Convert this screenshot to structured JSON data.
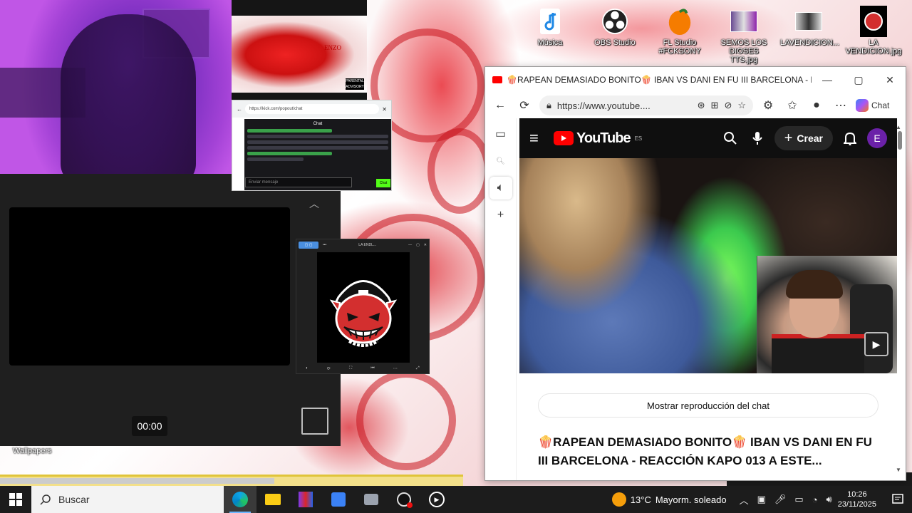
{
  "desktop": {
    "wallpapers_label": "Wallpapers",
    "icons": [
      {
        "label": "Música",
        "icon": "music-note-icon"
      },
      {
        "label": "OBS Studio",
        "icon": "obs-icon"
      },
      {
        "label": "FL Studio #FCKSONY",
        "icon": "fl-studio-icon"
      },
      {
        "label": "SEMOS LOS DIOSES TTS.jpg",
        "icon": "image-file-icon"
      },
      {
        "label": "LAVENDICION...",
        "icon": "image-file-icon"
      },
      {
        "label": "LA VENDICION.jpg",
        "icon": "image-file-icon"
      }
    ]
  },
  "media_player": {
    "time": "00:00"
  },
  "album": {
    "tag": "ENZO"
  },
  "chat_popup": {
    "title": "Chat",
    "url": "https://kick.com/popout/chat",
    "input_placeholder": "Enviar mensaje",
    "send_label": "Chat"
  },
  "viewer": {
    "title": "LA ENDL..."
  },
  "browser": {
    "tab_title": "🍿RAPEAN DEMASIADO BONITO🍿 IBAN VS DANI EN FU III BARCELONA - REACCI...",
    "url": "https://www.youtube....",
    "copilot_label": "Chat",
    "youtube": {
      "logo_text": "YouTube",
      "region": "ES",
      "create_label": "Crear",
      "avatar_letter": "E",
      "chat_replay_label": "Mostrar reproducción del chat",
      "video_title": "🍿RAPEAN DEMASIADO BONITO🍿 IBAN VS DANI EN FU III BARCELONA - REACCIÓN KAPO 013 A ESTE..."
    }
  },
  "taskbar": {
    "search_placeholder": "Buscar",
    "weather_temp": "13°C",
    "weather_desc": "Mayorm. soleado",
    "time": "10:26",
    "date": "23/11/2025"
  },
  "colors": {
    "youtube_red": "#ff0000",
    "taskbar_bg": "#1c1c1c",
    "kick_green": "#53fc18"
  }
}
